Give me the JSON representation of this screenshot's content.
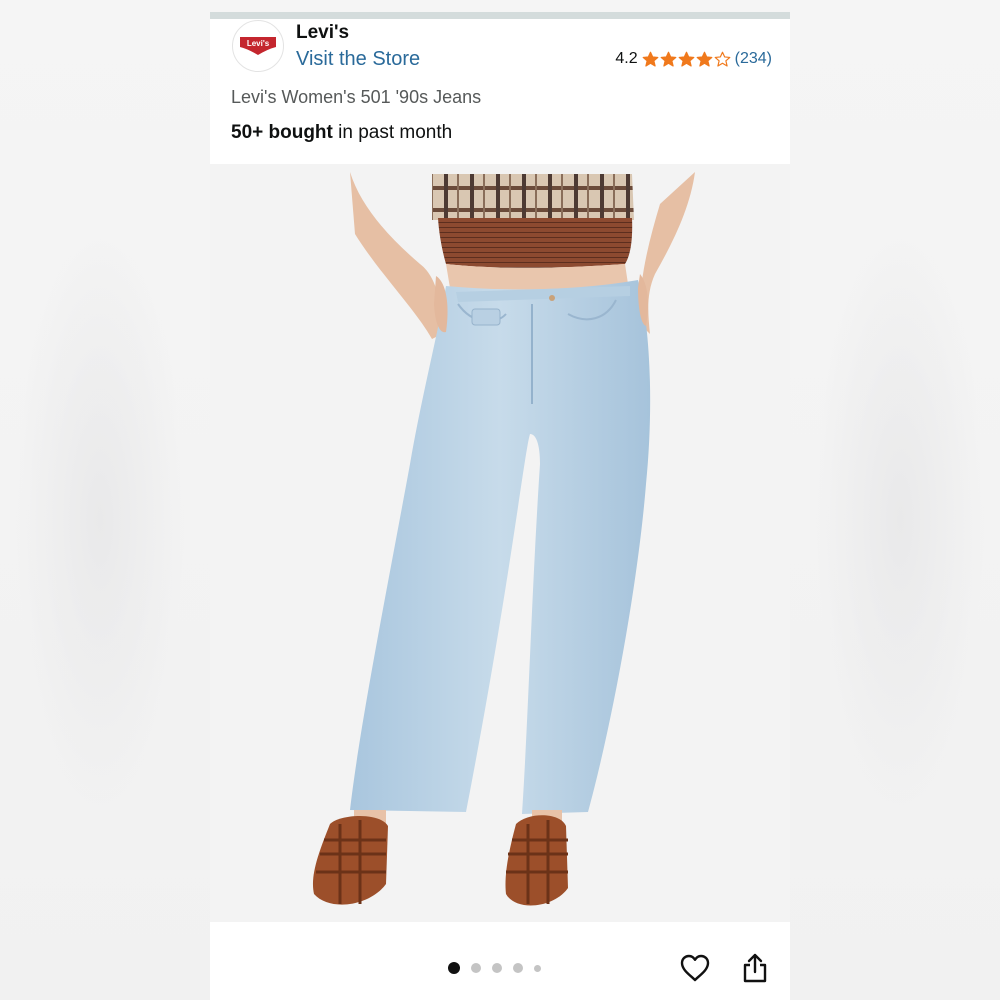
{
  "store": {
    "brand_name": "Levi's",
    "visit_label": "Visit the Store",
    "logo_text": "Levi's"
  },
  "rating": {
    "value": "4.2",
    "stars": 4.2,
    "count": "(234)",
    "star_color": "#f0791c"
  },
  "product": {
    "title": "Levi's Women's 501 '90s Jeans",
    "bought_bold": "50+ bought",
    "bought_rest": " in past month"
  },
  "gallery": {
    "image_icon": "product-photo",
    "total_images": 5,
    "active_index": 0
  },
  "actions": {
    "favorite_icon": "heart-icon",
    "share_icon": "share-icon"
  },
  "colors": {
    "link": "#2a6a9a",
    "brand_red": "#c4262e"
  }
}
